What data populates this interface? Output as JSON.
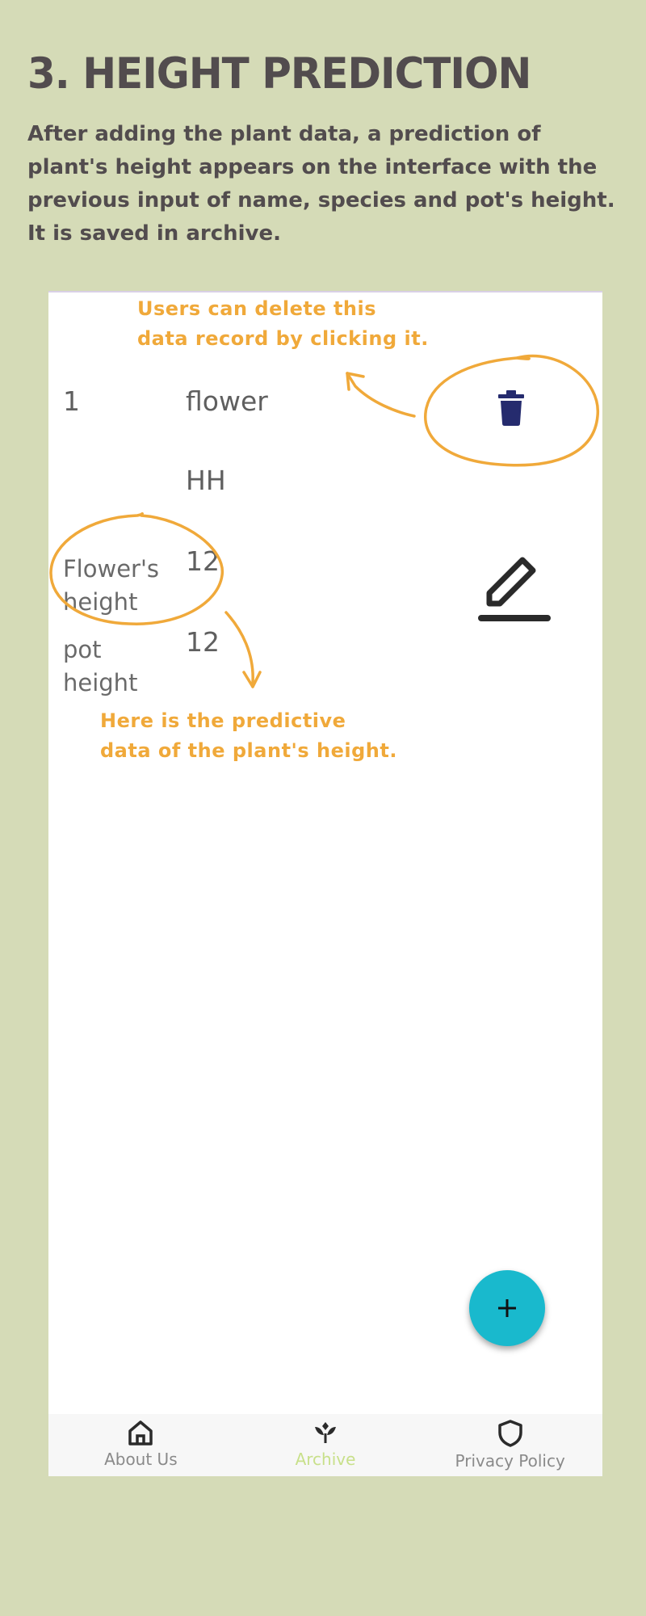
{
  "heading": "3. HEIGHT PREDICTION",
  "description": "After adding the plant data, a prediction of plant's height appears on the interface with the previous input of name, species and pot's height. It is saved in archive.",
  "record": {
    "id": "1",
    "name": "flower",
    "species": "HH",
    "flower_height_label": "Flower's height",
    "flower_height_value": "12",
    "pot_height_label": "pot height",
    "pot_height_value": "12"
  },
  "annotations": {
    "delete_note": [
      "Users can delete this",
      "data record by clicking it."
    ],
    "prediction_note": [
      "Here is the predictive",
      "data of the plant's height."
    ]
  },
  "nav": {
    "items": [
      {
        "label": "About Us",
        "icon": "home-icon",
        "active": false
      },
      {
        "label": "Archive",
        "icon": "sprout-icon",
        "active": true
      },
      {
        "label": "Privacy Policy",
        "icon": "shield-icon",
        "active": false
      }
    ]
  },
  "colors": {
    "background": "#d5dbb7",
    "heading_text": "#524c4e",
    "annotation": "#f0a93a",
    "delete_icon": "#252b6e",
    "fab": "#19b9cd",
    "nav_active": "#c8e08a"
  },
  "icons": {
    "delete": "trash-icon",
    "edit": "pencil-icon",
    "add": "plus-icon"
  }
}
